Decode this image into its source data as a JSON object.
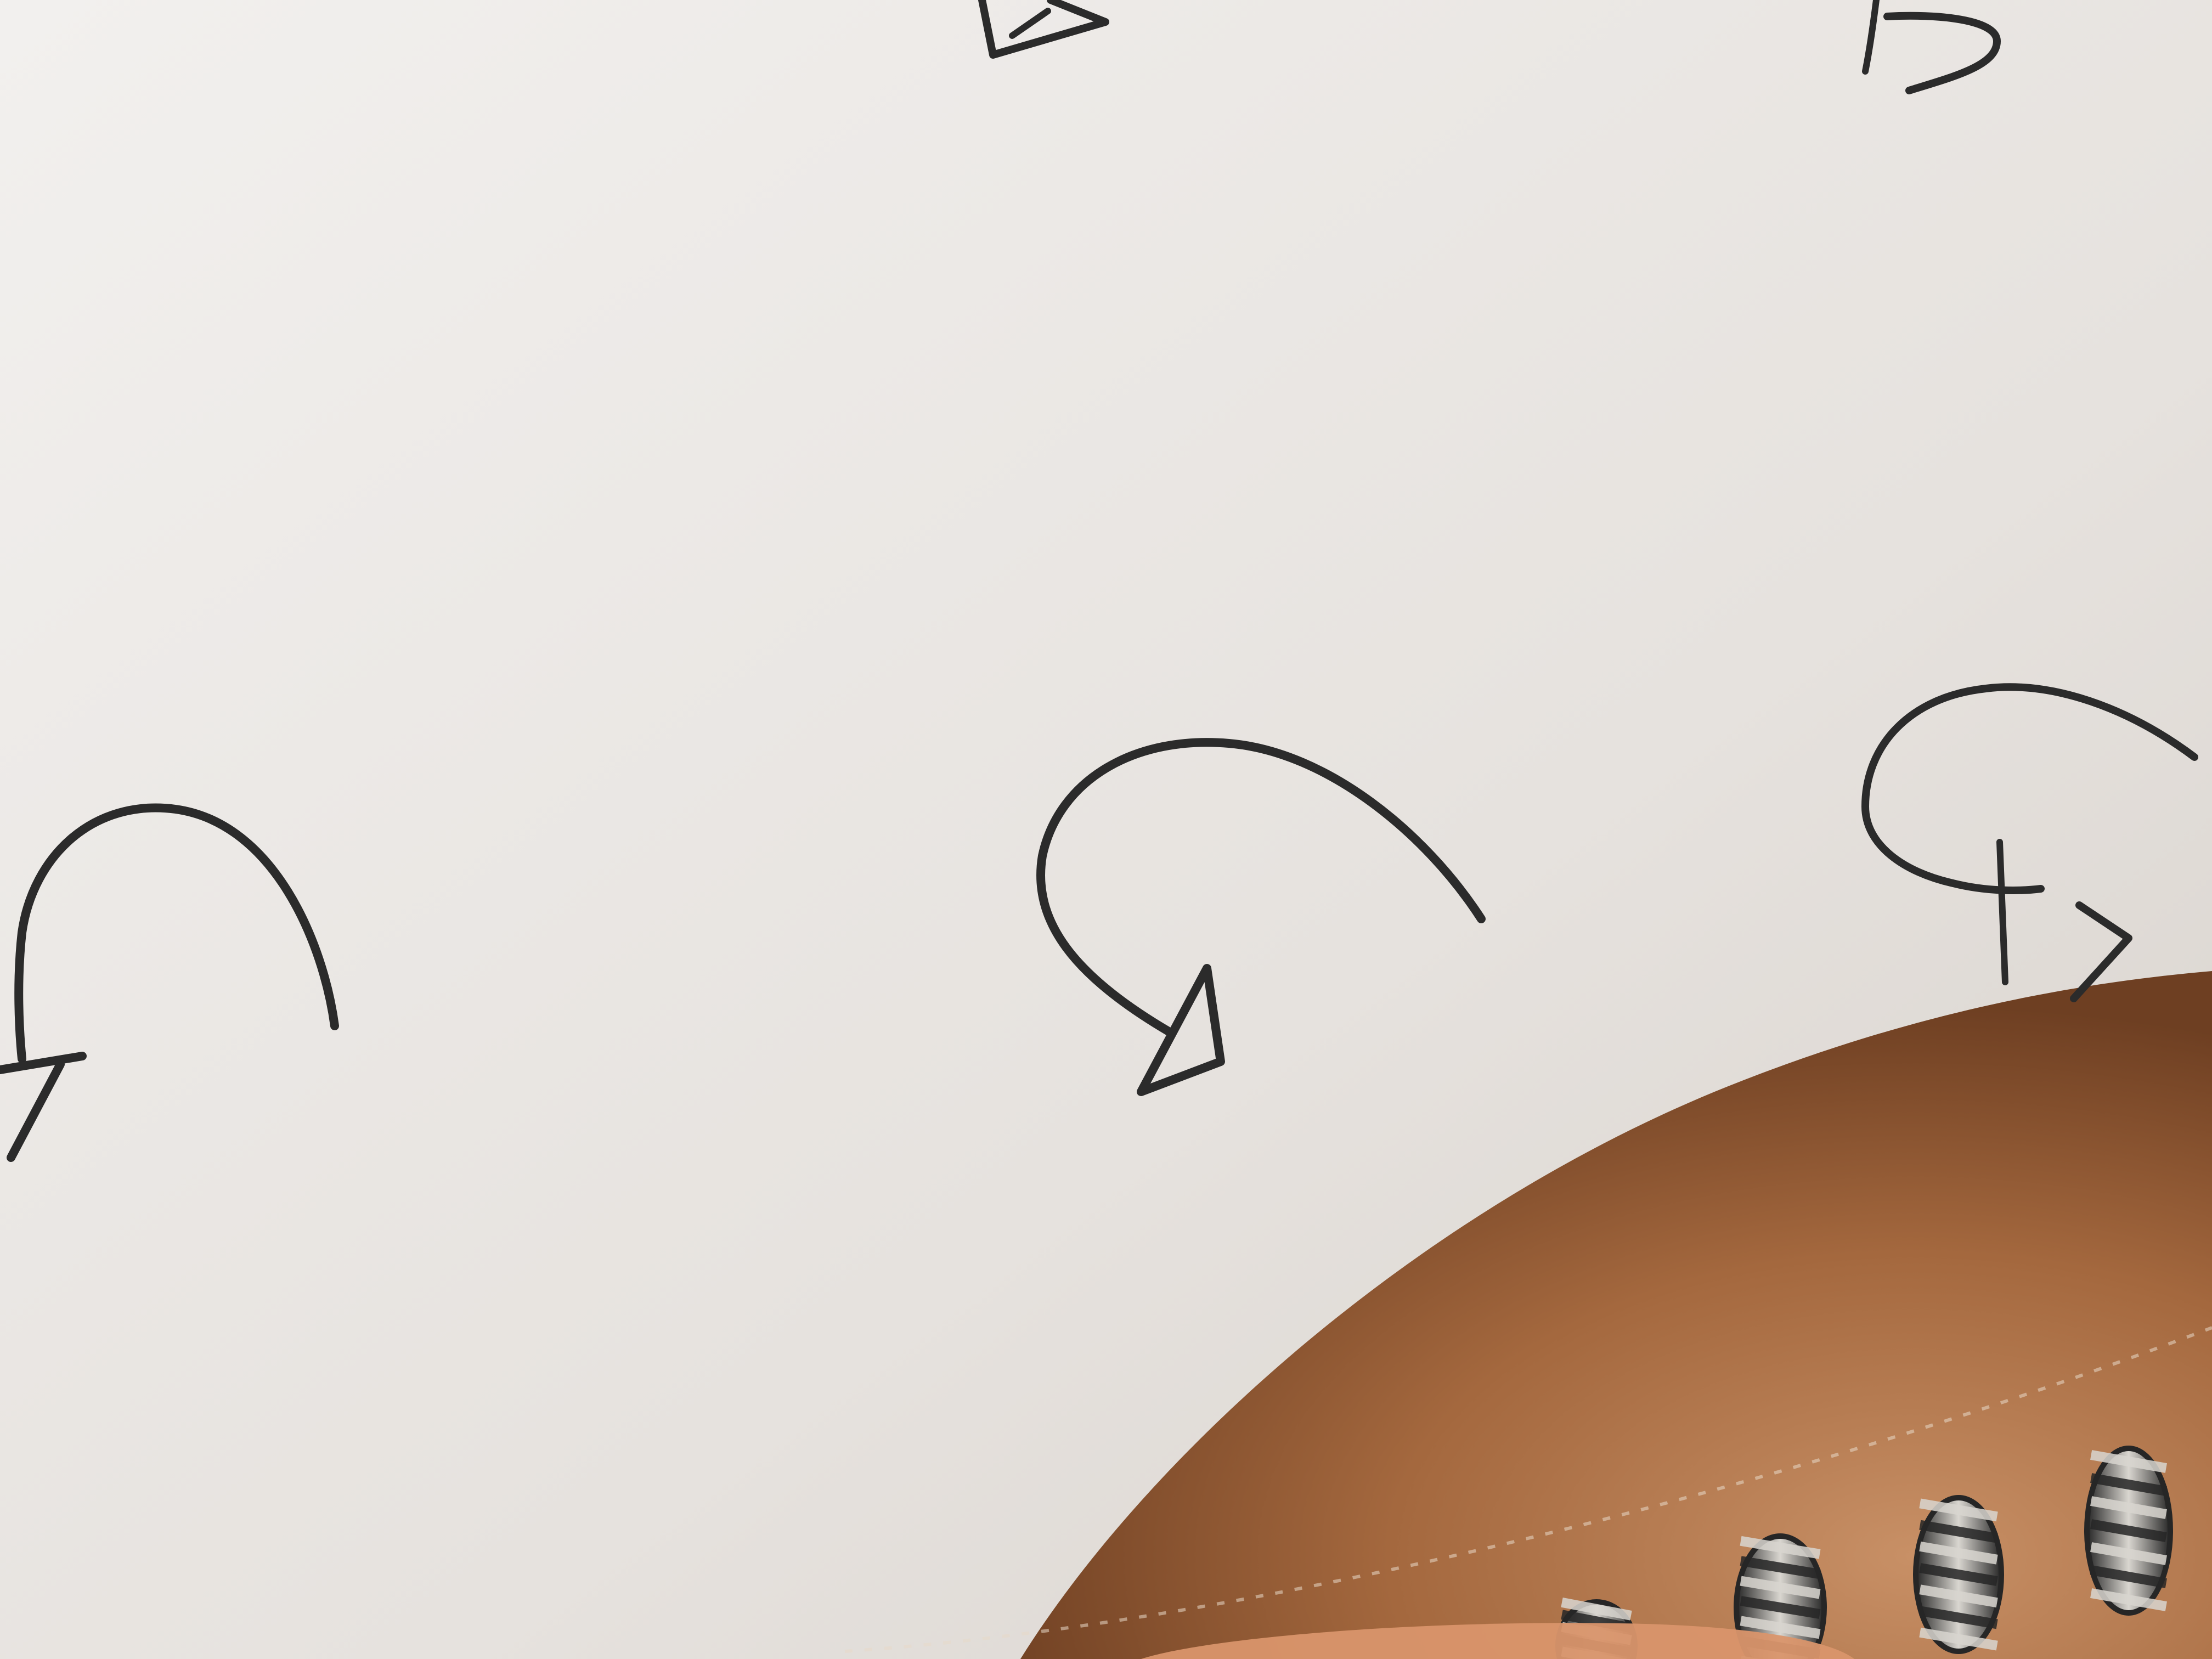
{
  "scene": {
    "subject": "hand-drawn-arrows-on-paper",
    "colors": {
      "paper_light": "#f2f0ee",
      "paper_mid": "#e6e2de",
      "paper_shadow": "#d6d0ca",
      "ink": "#2b2b2b",
      "cover_light": "#c89066",
      "cover_mid": "#a4683e",
      "cover_dark": "#6e3f22",
      "binding_dark": "#262626",
      "binding_light": "#d9d6d0",
      "finger": "#d9956b"
    },
    "drawn_marks": [
      {
        "name": "curved-arrow-center",
        "icon": "curved-arrow-icon"
      },
      {
        "name": "curved-arrow-left",
        "icon": "curved-arrow-icon"
      },
      {
        "name": "curved-arrow-right",
        "icon": "curved-arrow-icon"
      },
      {
        "name": "arrowhead-top",
        "icon": "arrowhead-icon"
      },
      {
        "name": "arrow-stroke-top-right",
        "icon": "curved-arrow-icon"
      }
    ],
    "spiral_ring_count": 4
  }
}
